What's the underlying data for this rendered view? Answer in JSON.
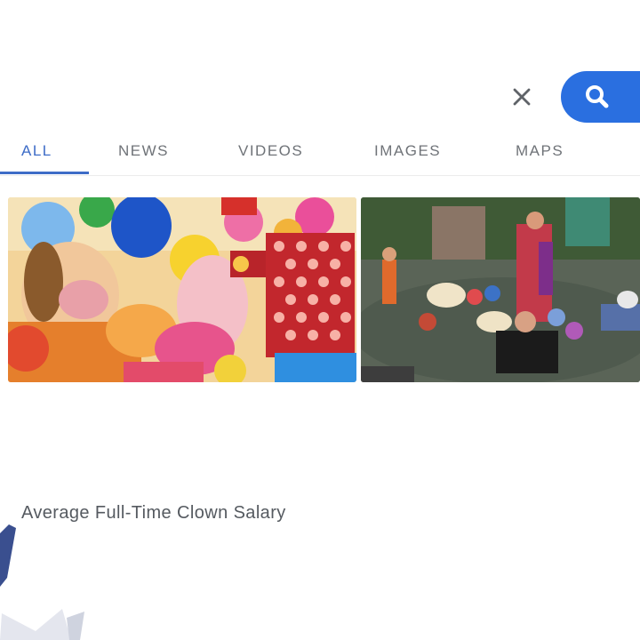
{
  "search": {
    "clear_icon": "close-icon",
    "button_icon": "search-icon",
    "button_color": "#2a6fe0"
  },
  "tabs": [
    {
      "label": "ALL",
      "active": true
    },
    {
      "label": "NEWS",
      "active": false
    },
    {
      "label": "VIDEOS",
      "active": false
    },
    {
      "label": "IMAGES",
      "active": false
    },
    {
      "label": "MAPS",
      "active": false
    }
  ],
  "accent_color": "#3d6cc7",
  "results": {
    "title": "Average Full-Time Clown Salary"
  }
}
